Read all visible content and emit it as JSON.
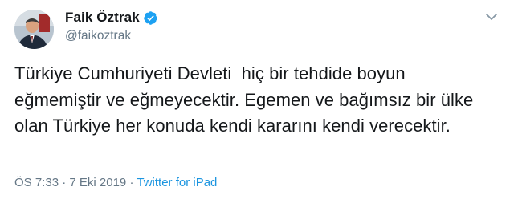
{
  "author": {
    "display_name": "Faik Öztrak",
    "handle": "@faikoztrak",
    "verified": true
  },
  "tweet": {
    "text": "Türkiye Cumhuriyeti Devleti  hiç bir tehdide boyun eğmemiştir ve eğmeyecektir. Egemen ve bağımsız bir ülke olan Türkiye her konuda kendi kararını kendi verecektir."
  },
  "meta": {
    "time": "ÖS 7:33",
    "separator1": "·",
    "date": "7 Eki 2019",
    "separator2": "·",
    "source": "Twitter for iPad"
  },
  "icons": {
    "verified": "verified-badge-icon",
    "caret": "chevron-down-icon"
  },
  "colors": {
    "link": "#1b95e0",
    "secondary_text": "#657786",
    "verified": "#1da1f2"
  }
}
